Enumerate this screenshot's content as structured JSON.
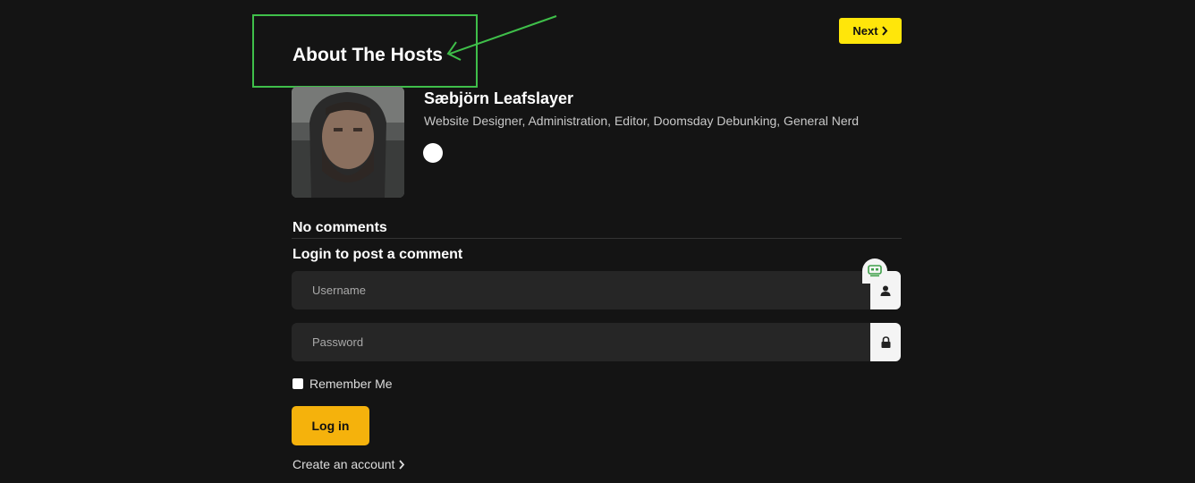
{
  "nav": {
    "next_label": "Next",
    "next_icon": "chevron-right-icon"
  },
  "hosts": {
    "title": "About The Hosts",
    "host": {
      "name": "Sæbjörn Leafslayer",
      "roles": "Website Designer, Administration, Editor, Doomsday Debunking, General Nerd"
    }
  },
  "comments": {
    "no_comments": "No comments",
    "login_title": "Login to post a comment"
  },
  "login_form": {
    "username_placeholder": "Username",
    "password_placeholder": "Password",
    "remember_label": "Remember Me",
    "remember_checked": false,
    "login_label": "Log in",
    "create_account_label": "Create an account"
  },
  "colors": {
    "background": "#141414",
    "next_button": "#ffe60a",
    "login_button": "#f5b20c",
    "annotation": "#3fbf4a"
  }
}
